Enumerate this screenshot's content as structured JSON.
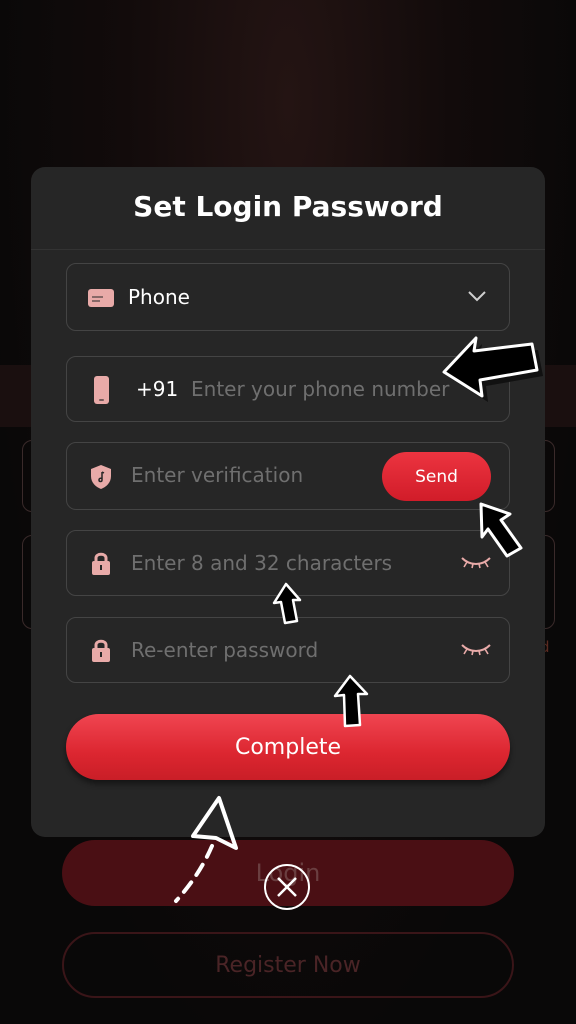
{
  "background": {
    "login_label": "Login",
    "register_label": "Register Now",
    "side_text": "d"
  },
  "dialog": {
    "title": "Set Login Password",
    "method_select": {
      "value": "Phone"
    },
    "phone_field": {
      "country_code": "+91",
      "placeholder": "Enter your phone number"
    },
    "verification_field": {
      "placeholder": "Enter verification",
      "send_label": "Send"
    },
    "password_field": {
      "placeholder": "Enter 8 and 32 characters"
    },
    "confirm_field": {
      "placeholder": "Re-enter password"
    },
    "complete_label": "Complete"
  },
  "colors": {
    "accent": "#e0262f",
    "icon_pink": "#e8aaa8",
    "modal_bg": "#262626",
    "field_border": "#444444"
  },
  "icons": [
    "card-icon",
    "chevron-down-icon",
    "phone-icon",
    "shield-icon",
    "lock-icon",
    "eye-closed-icon",
    "close-icon",
    "arrow-annotation"
  ]
}
